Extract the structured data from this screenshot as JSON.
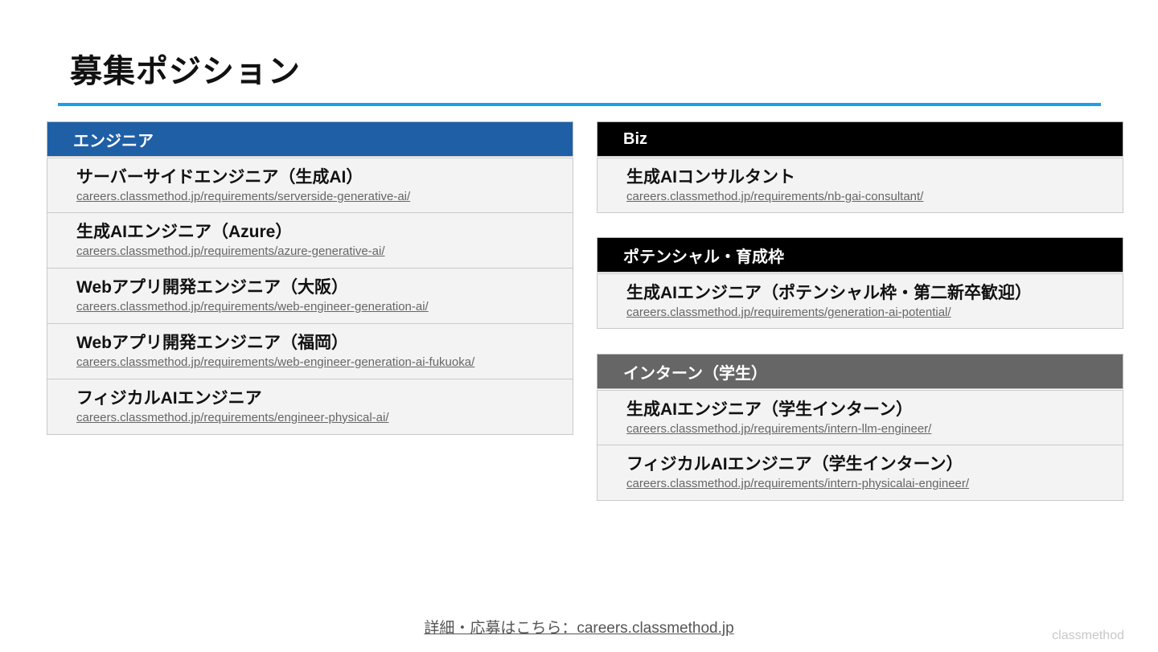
{
  "page_title": "募集ポジション",
  "accent_color": "#1aa0e6",
  "engineer": {
    "header": "エンジニア",
    "header_color": "#1f5fa6",
    "items": [
      {
        "title": "サーバーサイドエンジニア（生成AI）",
        "url": "careers.classmethod.jp/requirements/serverside-generative-ai/"
      },
      {
        "title": "生成AIエンジニア（Azure）",
        "url": "careers.classmethod.jp/requirements/azure-generative-ai/"
      },
      {
        "title": "Webアプリ開発エンジニア（大阪）",
        "url": "careers.classmethod.jp/requirements/web-engineer-generation-ai/"
      },
      {
        "title": "Webアプリ開発エンジニア（福岡）",
        "url": "careers.classmethod.jp/requirements/web-engineer-generation-ai-fukuoka/"
      },
      {
        "title": "フィジカルAIエンジニア",
        "url": "careers.classmethod.jp/requirements/engineer-physical-ai/"
      }
    ]
  },
  "biz": {
    "header": "Biz",
    "header_color": "#000000",
    "items": [
      {
        "title": "生成AIコンサルタント",
        "url": "careers.classmethod.jp/requirements/nb-gai-consultant/"
      }
    ]
  },
  "potential": {
    "header": "ポテンシャル・育成枠",
    "header_color": "#000000",
    "items": [
      {
        "title": "生成AIエンジニア（ポテンシャル枠・第二新卒歓迎）",
        "url": "careers.classmethod.jp/requirements/generation-ai-potential/"
      }
    ]
  },
  "intern": {
    "header": "インターン（学生）",
    "header_color": "#666666",
    "items": [
      {
        "title": "生成AIエンジニア（学生インターン）",
        "url": "careers.classmethod.jp/requirements/intern-llm-engineer/"
      },
      {
        "title": "フィジカルAIエンジニア（学生インターン）",
        "url": "careers.classmethod.jp/requirements/intern-physicalai-engineer/"
      }
    ]
  },
  "footer": {
    "text": "詳細・応募はこちら：careers.classmethod.jp"
  },
  "brand": "classmethod"
}
